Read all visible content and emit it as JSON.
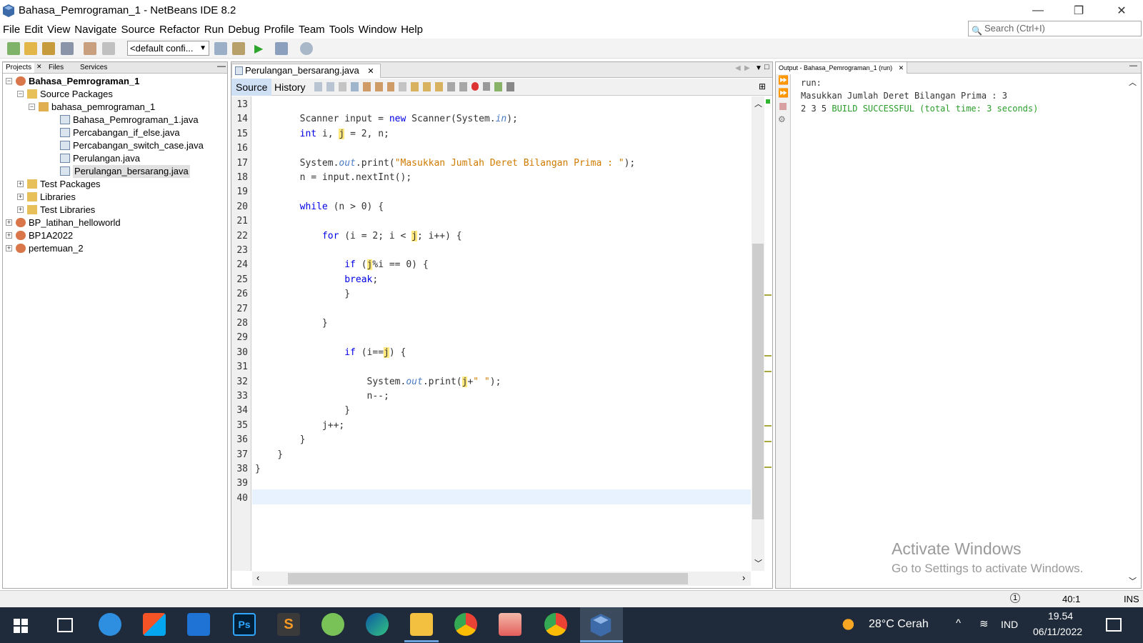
{
  "window": {
    "title": "Bahasa_Pemrograman_1 - NetBeans IDE 8.2",
    "minimize": "—",
    "maximize": "❐",
    "close": "✕"
  },
  "menu": [
    "File",
    "Edit",
    "View",
    "Navigate",
    "Source",
    "Refactor",
    "Run",
    "Debug",
    "Profile",
    "Team",
    "Tools",
    "Window",
    "Help"
  ],
  "search": {
    "placeholder": "Search (Ctrl+I)"
  },
  "toolbar": {
    "config": "<default confi..."
  },
  "projects": {
    "tabs": [
      "Projects",
      "Files",
      "Services"
    ],
    "tree": [
      {
        "label": "Bahasa_Pemrograman_1",
        "level": 0,
        "bold": true,
        "expander": "−",
        "icon": "project"
      },
      {
        "label": "Source Packages",
        "level": 1,
        "expander": "−",
        "icon": "folder"
      },
      {
        "label": "bahasa_pemrograman_1",
        "level": 2,
        "expander": "−",
        "icon": "package"
      },
      {
        "label": "Bahasa_Pemrograman_1.java",
        "level": 3,
        "icon": "java"
      },
      {
        "label": "Percabangan_if_else.java",
        "level": 3,
        "icon": "java"
      },
      {
        "label": "Percabangan_switch_case.java",
        "level": 3,
        "icon": "java"
      },
      {
        "label": "Perulangan.java",
        "level": 3,
        "icon": "java"
      },
      {
        "label": "Perulangan_bersarang.java",
        "level": 3,
        "icon": "java",
        "selected": true
      },
      {
        "label": "Test Packages",
        "level": 1,
        "expander": "+",
        "icon": "folder"
      },
      {
        "label": "Libraries",
        "level": 1,
        "expander": "+",
        "icon": "folder"
      },
      {
        "label": "Test Libraries",
        "level": 1,
        "expander": "+",
        "icon": "folder"
      },
      {
        "label": "BP_latihan_helloworld",
        "level": 0,
        "expander": "+",
        "icon": "project"
      },
      {
        "label": "BP1A2022",
        "level": 0,
        "expander": "+",
        "icon": "project"
      },
      {
        "label": "pertemuan_2",
        "level": 0,
        "expander": "+",
        "icon": "project"
      }
    ]
  },
  "editor": {
    "tab": "Perulangan_bersarang.java",
    "source_btn": "Source",
    "history_btn": "History",
    "lines": [
      {
        "n": "13",
        "html": ""
      },
      {
        "n": "14",
        "html": "        Scanner input = <span class=\"kw\">new</span> Scanner(System.<span class=\"it\">in</span>);"
      },
      {
        "n": "15",
        "html": "        <span class=\"kw\">int</span> i, <span class=\"hl\">j</span> = 2, n;"
      },
      {
        "n": "16",
        "html": ""
      },
      {
        "n": "17",
        "html": "        System.<span class=\"it\">out</span>.print(<span class=\"st\">\"Masukkan Jumlah Deret Bilangan Prima : \"</span>);"
      },
      {
        "n": "18",
        "html": "        n = input.nextInt();"
      },
      {
        "n": "19",
        "html": ""
      },
      {
        "n": "20",
        "html": "        <span class=\"kw\">while</span> (n > 0) {"
      },
      {
        "n": "21",
        "html": ""
      },
      {
        "n": "22",
        "html": "            <span class=\"kw\">for</span> (i = 2; i < <span class=\"hl\">j</span>; i++) {"
      },
      {
        "n": "23",
        "html": ""
      },
      {
        "n": "24",
        "html": "                <span class=\"kw\">if</span> (<span class=\"hl\">j</span>%i == 0) {"
      },
      {
        "n": "25",
        "html": "                <span class=\"kw\">break</span>;"
      },
      {
        "n": "26",
        "html": "                }"
      },
      {
        "n": "27",
        "html": ""
      },
      {
        "n": "28",
        "html": "            }"
      },
      {
        "n": "29",
        "html": ""
      },
      {
        "n": "30",
        "html": "                <span class=\"kw\">if</span> (i==<span class=\"hl\">j</span>) {"
      },
      {
        "n": "31",
        "html": ""
      },
      {
        "n": "32",
        "html": "                    System.<span class=\"it\">out</span>.print(<span class=\"hl\">j</span>+<span class=\"st\">\" \"</span>);"
      },
      {
        "n": "33",
        "html": "                    n--;"
      },
      {
        "n": "34",
        "html": "                }"
      },
      {
        "n": "35",
        "html": "            j++;"
      },
      {
        "n": "36",
        "html": "        }"
      },
      {
        "n": "37",
        "html": "    }"
      },
      {
        "n": "38",
        "html": "}"
      },
      {
        "n": "39",
        "html": ""
      },
      {
        "n": "40",
        "html": ""
      }
    ]
  },
  "output": {
    "tab": "Output - Bahasa_Pemrograman_1 (run)",
    "line1": "run:",
    "line2": "Masukkan Jumlah Deret Bilangan Prima : 3",
    "line3a": "2 3 5 ",
    "line3b": "BUILD SUCCESSFUL (total time: 3 seconds)"
  },
  "watermark": {
    "line1": "Activate Windows",
    "line2": "Go to Settings to activate Windows."
  },
  "status": {
    "position": "40:1",
    "mode": "INS"
  },
  "taskbar": {
    "weather": "28°C  Cerah",
    "lang": "IND",
    "time": "19.54",
    "date": "06/11/2022"
  },
  "colors": {
    "keyword": "#0000e6",
    "string": "#ce7b00",
    "field": "#4a7cc4",
    "success": "#2a9d2a",
    "taskbar": "#1f2b3a"
  }
}
